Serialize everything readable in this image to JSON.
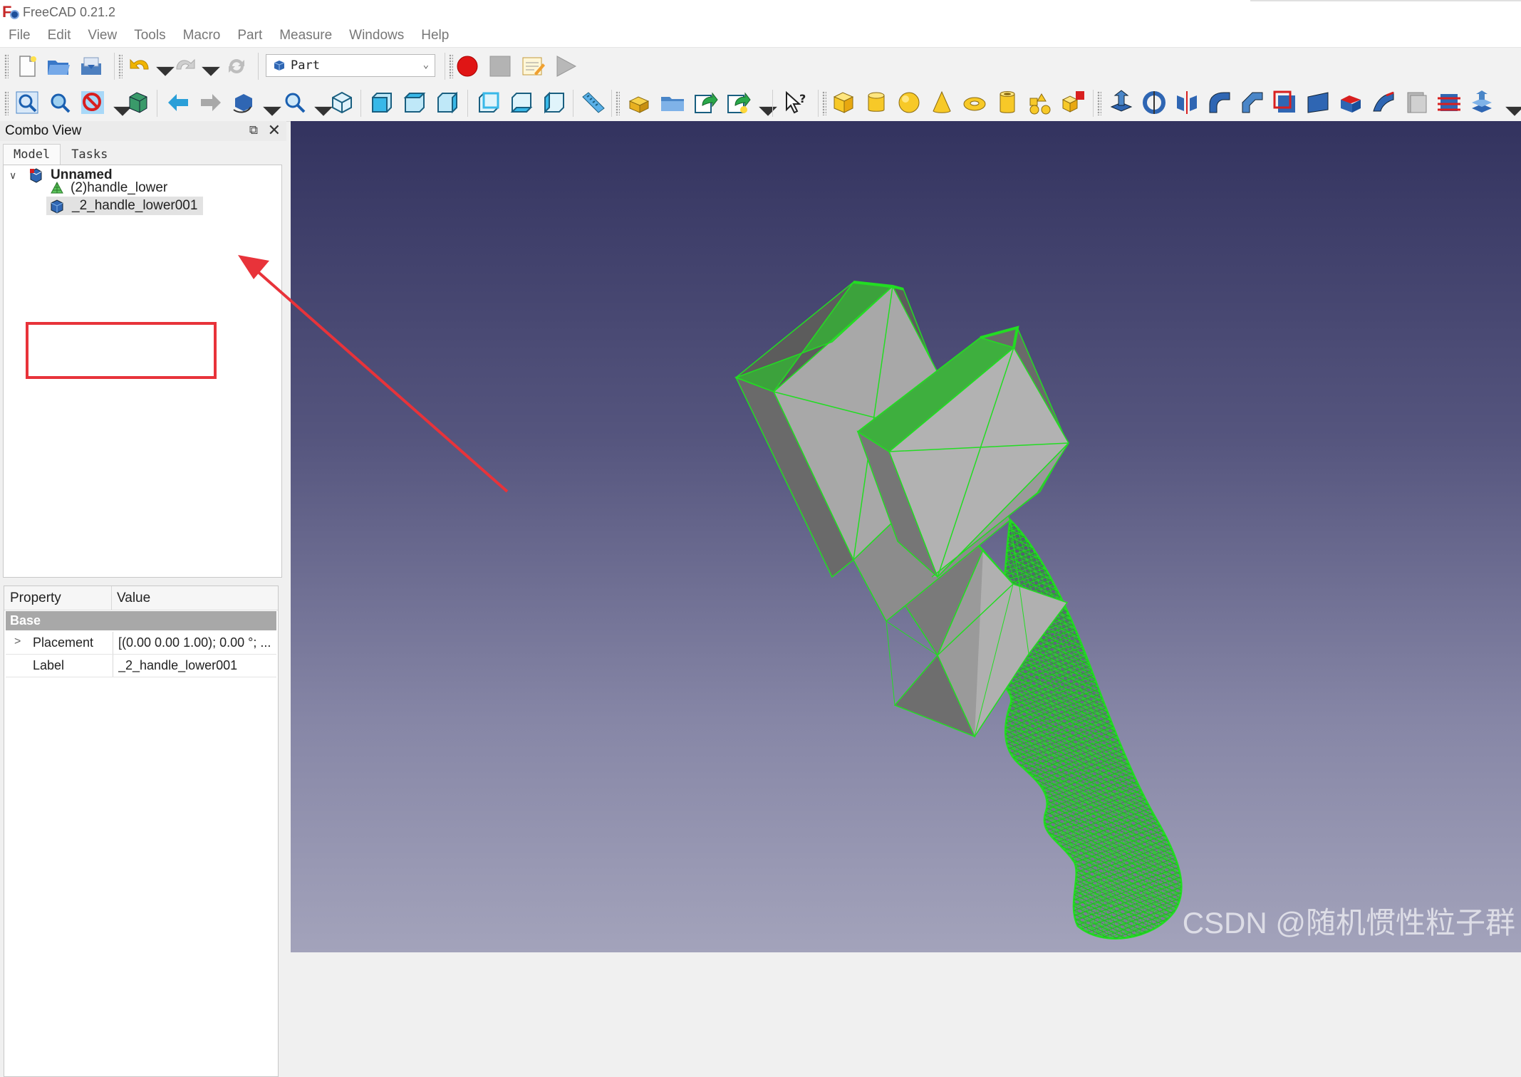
{
  "window": {
    "title": "FreeCAD 0.21.2"
  },
  "menu": [
    "File",
    "Edit",
    "View",
    "Tools",
    "Macro",
    "Part",
    "Measure",
    "Windows",
    "Help"
  ],
  "workbench": {
    "selected": "Part"
  },
  "toolbar_icons": {
    "file": [
      "new-document-icon",
      "open-document-icon",
      "save-document-icon"
    ],
    "edit": [
      "undo-icon",
      "redo-icon",
      "refresh-icon"
    ],
    "macro": [
      "record-macro-icon",
      "stop-macro-icon",
      "edit-macro-icon",
      "run-macro-icon"
    ],
    "view": [
      "fit-all-icon",
      "fit-selection-icon",
      "draw-style-icon",
      "bounding-box-icon",
      "back-icon",
      "forward-icon",
      "sync-view-icon",
      "std-zoom-icon",
      "isometric-view-icon",
      "front-view-icon",
      "top-view-icon",
      "right-view-icon",
      "rear-view-icon",
      "bottom-view-icon",
      "left-view-icon",
      "measure-distance-icon"
    ],
    "structure": [
      "part-icon",
      "group-icon",
      "link-icon",
      "link-actions-icon",
      "whats-this-icon"
    ],
    "part": [
      "cube-icon",
      "cylinder-icon",
      "sphere-icon",
      "cone-icon",
      "torus-icon",
      "tube-icon",
      "primitives-icon",
      "shape-builder-icon",
      "extrude-icon",
      "revolve-icon",
      "mirror-icon",
      "fillet-icon",
      "chamfer-icon",
      "make-face-icon",
      "ruled-surface-icon",
      "loft-icon",
      "sweep-icon",
      "section-icon",
      "cross-sections-icon",
      "offset-icon",
      "thickness-icon",
      "projection-icon"
    ]
  },
  "combo_view": {
    "title": "Combo View",
    "tabs": [
      "Model",
      "Tasks"
    ],
    "tree": {
      "root": "Unnamed",
      "children": [
        "(2)handle_lower",
        "_2_handle_lower001"
      ]
    }
  },
  "properties": {
    "headers": [
      "Property",
      "Value"
    ],
    "group": "Base",
    "rows": [
      {
        "key": "Placement",
        "value": "[(0.00 0.00 1.00); 0.00 °; ..."
      },
      {
        "key": "Label",
        "value": "_2_handle_lower001"
      }
    ]
  },
  "watermark": "CSDN @随机惯性粒子群",
  "colors": {
    "annotation_red": "#e8333a",
    "mesh_green": "#22dd22",
    "face_gray": "#a6a6a6"
  }
}
